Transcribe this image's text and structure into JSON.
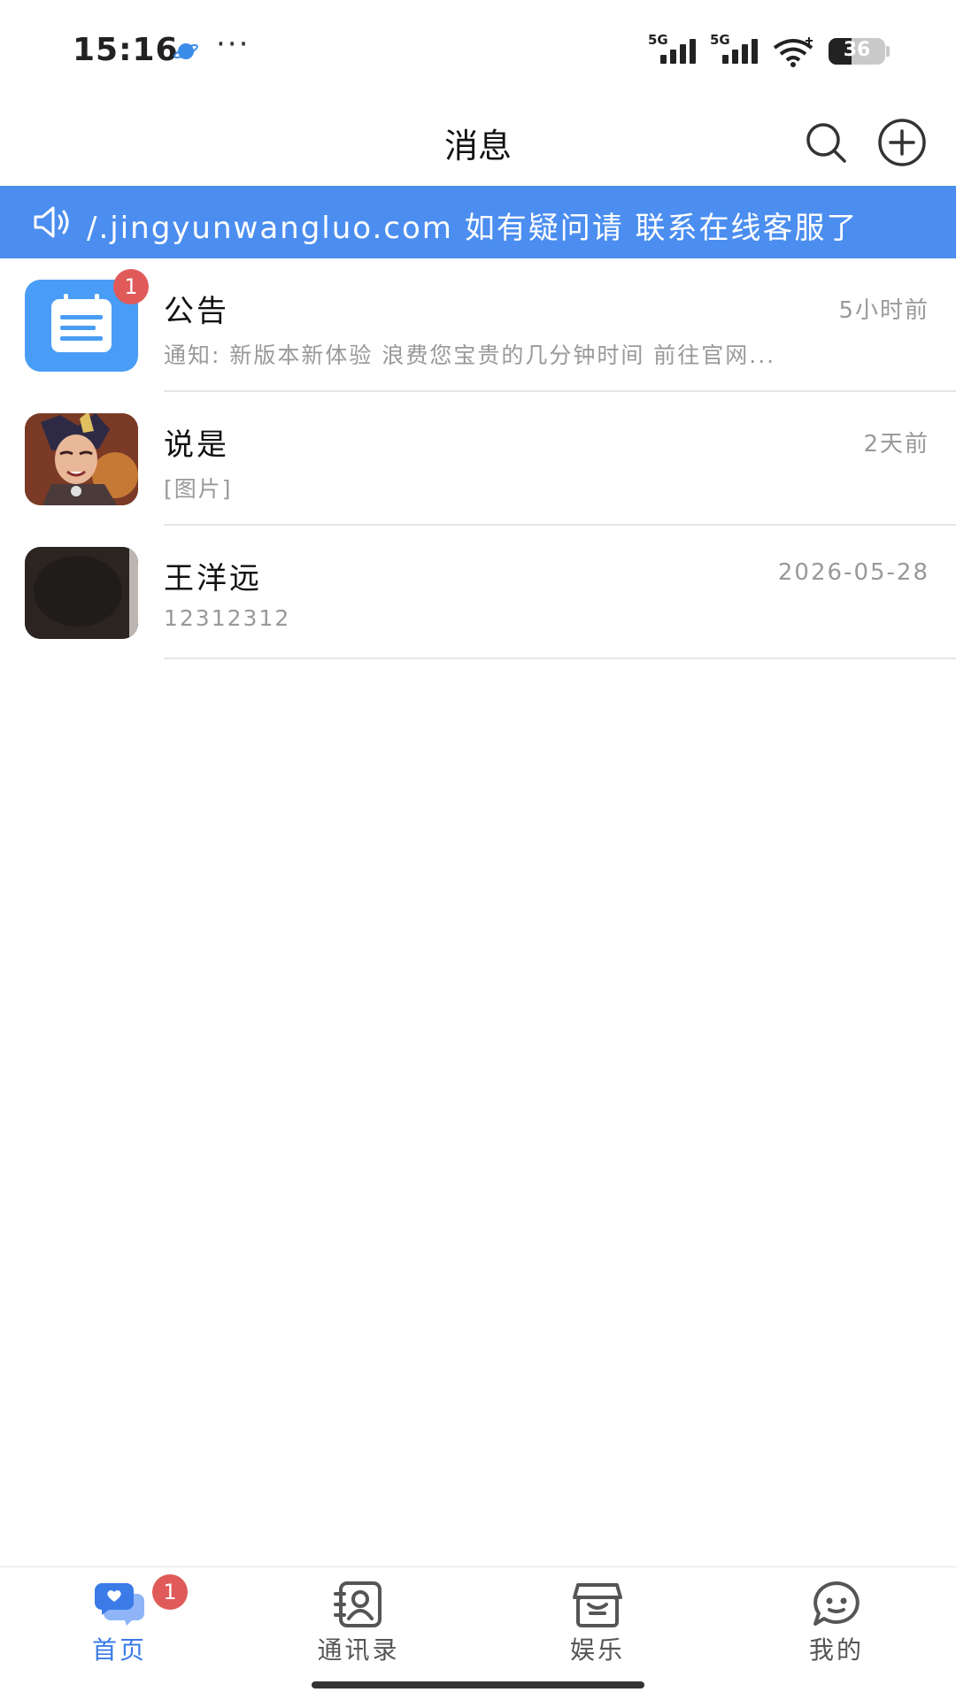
{
  "status_bar": {
    "time": "15:16",
    "more": "···",
    "signal_1_label": "5G",
    "signal_2_label": "5G",
    "battery": "36",
    "app_icon": "browser-planet-icon"
  },
  "header": {
    "title": "消息",
    "search_icon": "search-icon",
    "add_icon": "plus-circle-icon"
  },
  "notice_bar": {
    "icon": "speaker-icon",
    "text": "/.jingyunwangluo.com 如有疑问请 联系在线客服了"
  },
  "conversations": [
    {
      "name": "公告",
      "time": "5小时前",
      "preview": "通知: 新版本新体验 浪费您宝贵的几分钟时间 前往官网...",
      "badge": "1",
      "avatar": "notice-calendar-icon"
    },
    {
      "name": "说是",
      "time": "2天前",
      "preview": "[图片]",
      "avatar": "game-character-avatar"
    },
    {
      "name": "王洋远",
      "time": "2026-05-28",
      "preview": "12312312",
      "avatar": "dark-photo-avatar"
    }
  ],
  "tabbar": {
    "tabs": [
      {
        "label": "首页",
        "icon": "chat-bubbles-icon",
        "active": true,
        "badge": "1"
      },
      {
        "label": "通讯录",
        "icon": "contacts-book-icon",
        "active": false
      },
      {
        "label": "娱乐",
        "icon": "store-box-icon",
        "active": false
      },
      {
        "label": "我的",
        "icon": "smiley-bubble-icon",
        "active": false
      }
    ]
  },
  "colors": {
    "accent": "#4b8ef0",
    "active_tab": "#3a7be8",
    "badge": "#e05a5a"
  }
}
